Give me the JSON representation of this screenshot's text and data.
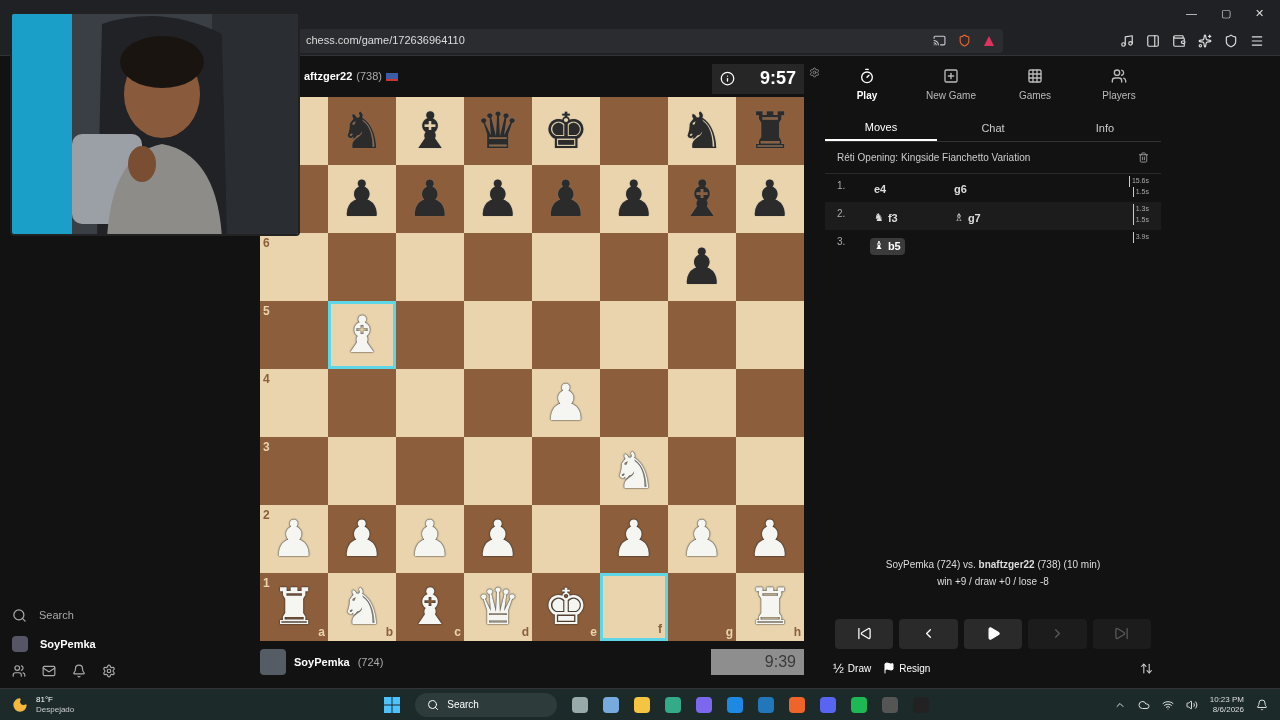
{
  "browser": {
    "url": "chess.com/game/172636964110",
    "window_controls": [
      "—",
      "▢",
      "✕"
    ]
  },
  "sidebar": {
    "search": "Search",
    "user": "SoyPemka"
  },
  "opponent": {
    "name": "aftzger22",
    "rating": "(738)",
    "clock": "9:57"
  },
  "player": {
    "name": "SoyPemka",
    "rating": "(724)",
    "clock": "9:39"
  },
  "board": [
    [
      {
        "highlighted": false
      },
      {
        "piece": "♞",
        "white": false,
        "highlighted": false
      },
      {
        "piece": "♝",
        "white": false,
        "highlighted": false
      },
      {
        "piece": "♛",
        "white": false,
        "highlighted": false
      },
      {
        "piece": "♚",
        "white": false,
        "highlighted": false
      },
      {
        "highlighted": false
      },
      {
        "piece": "♞",
        "white": false,
        "highlighted": false
      },
      {
        "piece": "♜",
        "white": false,
        "highlighted": false
      }
    ],
    [
      {
        "highlighted": false
      },
      {
        "piece": "♟",
        "white": false,
        "highlighted": false
      },
      {
        "piece": "♟",
        "white": false,
        "highlighted": false
      },
      {
        "piece": "♟",
        "white": false,
        "highlighted": false
      },
      {
        "piece": "♟",
        "white": false,
        "highlighted": false
      },
      {
        "piece": "♟",
        "white": false,
        "highlighted": false
      },
      {
        "piece": "♝",
        "white": false,
        "highlighted": false
      },
      {
        "piece": "♟",
        "white": false,
        "highlighted": false
      }
    ],
    [
      {
        "rank": "6",
        "highlighted": false
      },
      {
        "highlighted": false
      },
      {
        "highlighted": false
      },
      {
        "highlighted": false
      },
      {
        "highlighted": false
      },
      {
        "highlighted": false
      },
      {
        "piece": "♟",
        "white": false,
        "highlighted": false
      },
      {
        "highlighted": false
      }
    ],
    [
      {
        "rank": "5",
        "highlighted": false
      },
      {
        "piece": "♝",
        "white": true,
        "highlighted": true
      },
      {
        "highlighted": false
      },
      {
        "highlighted": false
      },
      {
        "highlighted": false
      },
      {
        "highlighted": false
      },
      {
        "highlighted": false
      },
      {
        "highlighted": false
      }
    ],
    [
      {
        "rank": "4",
        "highlighted": false
      },
      {
        "highlighted": false
      },
      {
        "highlighted": false
      },
      {
        "highlighted": false
      },
      {
        "piece": "♟",
        "white": true,
        "highlighted": false
      },
      {
        "highlighted": false
      },
      {
        "highlighted": false
      },
      {
        "highlighted": false
      }
    ],
    [
      {
        "rank": "3",
        "highlighted": false
      },
      {
        "highlighted": false
      },
      {
        "highlighted": false
      },
      {
        "highlighted": false
      },
      {
        "highlighted": false
      },
      {
        "piece": "♞",
        "white": true,
        "highlighted": false
      },
      {
        "highlighted": false
      },
      {
        "highlighted": false
      }
    ],
    [
      {
        "rank": "2",
        "piece": "♟",
        "white": true,
        "highlighted": false
      },
      {
        "piece": "♟",
        "white": true,
        "highlighted": false
      },
      {
        "piece": "♟",
        "white": true,
        "highlighted": false
      },
      {
        "piece": "♟",
        "white": true,
        "highlighted": false
      },
      {
        "highlighted": false
      },
      {
        "piece": "♟",
        "white": true,
        "highlighted": false
      },
      {
        "piece": "♟",
        "white": true,
        "highlighted": false
      },
      {
        "piece": "♟",
        "white": true,
        "highlighted": false
      }
    ],
    [
      {
        "rank": "1",
        "file": "a",
        "piece": "♜",
        "white": true,
        "highlighted": false
      },
      {
        "file": "b",
        "piece": "♞",
        "white": true,
        "highlighted": false
      },
      {
        "file": "c",
        "piece": "♝",
        "white": true,
        "highlighted": false
      },
      {
        "file": "d",
        "piece": "♛",
        "white": true,
        "highlighted": false
      },
      {
        "file": "e",
        "piece": "♚",
        "white": true,
        "highlighted": false
      },
      {
        "file": "f",
        "highlighted": true
      },
      {
        "file": "g",
        "highlighted": false
      },
      {
        "file": "h",
        "piece": "♜",
        "white": true,
        "highlighted": false
      }
    ]
  ],
  "nav": [
    {
      "kind": "timer",
      "label": "Play",
      "selected": true
    },
    {
      "kind": "plus",
      "label": "New Game",
      "selected": false
    },
    {
      "kind": "grid",
      "label": "Games",
      "selected": false
    },
    {
      "kind": "users",
      "label": "Players",
      "selected": false
    }
  ],
  "tabs": [
    {
      "label": "Moves",
      "selected": true
    },
    {
      "label": "Chat",
      "selected": false
    },
    {
      "label": "Info",
      "selected": false
    }
  ],
  "opening": "Réti Opening: Kingside Fianchetto Variation",
  "moves": [
    {
      "number": "1.",
      "white": {
        "san": "e4",
        "selected": false
      },
      "black": {
        "san": "g6",
        "selected": false
      },
      "times": [
        "15.6s",
        "1.5s"
      ]
    },
    {
      "number": "2.",
      "white": {
        "piece": "♞",
        "san": "f3",
        "selected": false
      },
      "black": {
        "piece": "♗",
        "san": "g7",
        "selected": false
      },
      "times": [
        "1.3s",
        "1.5s"
      ]
    },
    {
      "number": "3.",
      "white": {
        "piece": "♝",
        "san": "b5",
        "selected": true
      },
      "times": [
        "3.9s"
      ]
    }
  ],
  "game_info": {
    "line": "SoyPemka (724) vs. **bnaftzger22** (738) (10 min)",
    "stakes": "win +9 / draw +0 / lose -8"
  },
  "controls": [
    {
      "kind": "first",
      "disabled": false
    },
    {
      "kind": "prev",
      "disabled": false
    },
    {
      "kind": "play",
      "disabled": false
    },
    {
      "kind": "next",
      "disabled": true
    },
    {
      "kind": "last",
      "disabled": true
    }
  ],
  "actions": {
    "draw_symbol": "½",
    "draw": "Draw",
    "resign": "Resign"
  },
  "taskbar": {
    "temperature": "81°F",
    "weather": "Despejado",
    "search": "Search",
    "time": "10:23 PM",
    "date": "8/6/2026"
  }
}
